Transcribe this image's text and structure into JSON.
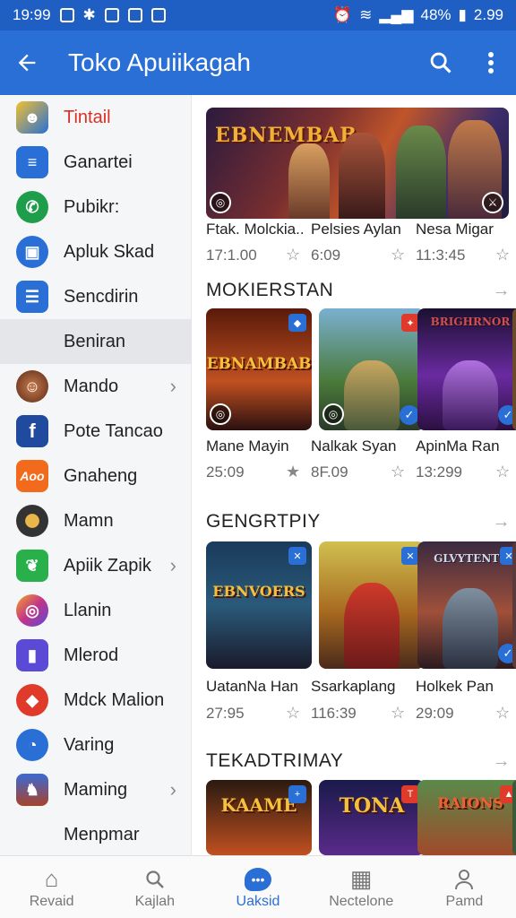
{
  "status": {
    "time": "19:99",
    "battery": "48%",
    "signal_time": "2.99"
  },
  "appbar": {
    "title": "Toko Apuiikagah",
    "back_icon": "arrow-left-icon",
    "search_icon": "search-icon",
    "more_icon": "more-vert-icon"
  },
  "sidebar": {
    "items": [
      {
        "label": "Tintail",
        "icon": "avatar-icon",
        "color": "#e6a23c"
      },
      {
        "label": "Ganartei",
        "icon": "document-icon",
        "color": "#2a6fd6"
      },
      {
        "label": "Pubikr:",
        "icon": "phone-icon",
        "color": "#1e9e4a"
      },
      {
        "label": "Apluk Skad",
        "icon": "store-icon",
        "color": "#2a6fd6"
      },
      {
        "label": "Sencdirin",
        "icon": "list-icon",
        "color": "#2a6fd6"
      },
      {
        "label": "Beniran",
        "icon": "",
        "color": ""
      },
      {
        "label": "Mando",
        "icon": "game-avatar-icon",
        "color": "#8a4a2a"
      },
      {
        "label": "Pote Tancao",
        "icon": "facebook-icon",
        "color": "#1f4a9e"
      },
      {
        "label": "Gnaheng",
        "icon": "aoo-icon",
        "color": "#f26b1d"
      },
      {
        "label": "Mamn",
        "icon": "tire-icon",
        "color": "#333333"
      },
      {
        "label": "Apiik Zapik",
        "icon": "leaf-icon",
        "color": "#29b04a"
      },
      {
        "label": "Llanin",
        "icon": "instagram-icon",
        "color": "#c2338a"
      },
      {
        "label": "Mlerod",
        "icon": "chart-icon",
        "color": "#5a4ad6"
      },
      {
        "label": "Mdck Malion",
        "icon": "cube-icon",
        "color": "#e03a2a"
      },
      {
        "label": "Varing",
        "icon": "chat-icon",
        "color": "#2a6fd6"
      },
      {
        "label": "Maming",
        "icon": "warrior-icon",
        "color": "#7a3a2a"
      },
      {
        "label": "Menpmar",
        "icon": "",
        "color": ""
      }
    ]
  },
  "banner": {
    "title": "EBNEMBAB"
  },
  "row1": {
    "titles": [
      "Ftak. Molckia..",
      "Pelsies Aylan",
      "Nesa Migar"
    ],
    "values": [
      "17:1.00",
      "6:09",
      "11:3:45"
    ]
  },
  "section1": {
    "title": "MOKIERSTAN",
    "cards": [
      {
        "art": "EBNAMBAB",
        "name": "Mane Mayin",
        "value": "25:09"
      },
      {
        "art": "",
        "name": "Nalkak Syan",
        "value": "8F.09"
      },
      {
        "art": "BRIGHRNOR",
        "name": "ApinMa Ran",
        "value": "13:299"
      }
    ]
  },
  "section2": {
    "title": "GENGRTPIY",
    "cards": [
      {
        "art": "EBNVOERS",
        "name": "UatanNa Han",
        "value": "27:95"
      },
      {
        "art": "",
        "name": "Ssarkaplang",
        "value": "116:39"
      },
      {
        "art": "GLVYTENTS",
        "name": "Holkek Pan",
        "value": "29:09"
      }
    ]
  },
  "section3": {
    "title": "TEKADTRIMAY",
    "cards": [
      {
        "art": "KAAME"
      },
      {
        "art": "TONA"
      },
      {
        "art": "RAIONS"
      }
    ]
  },
  "bottom_nav": [
    {
      "label": "Revaid",
      "icon": "home-icon"
    },
    {
      "label": "Kajlah",
      "icon": "search-icon"
    },
    {
      "label": "Uaksid",
      "icon": "chat-bubble-icon"
    },
    {
      "label": "Nectelone",
      "icon": "apps-grid-icon"
    },
    {
      "label": "Pamd",
      "icon": "profile-icon"
    }
  ],
  "colors": {
    "accent": "#2a6fd6",
    "status_bar": "#1f5fc4",
    "highlight_text": "#d93025"
  }
}
